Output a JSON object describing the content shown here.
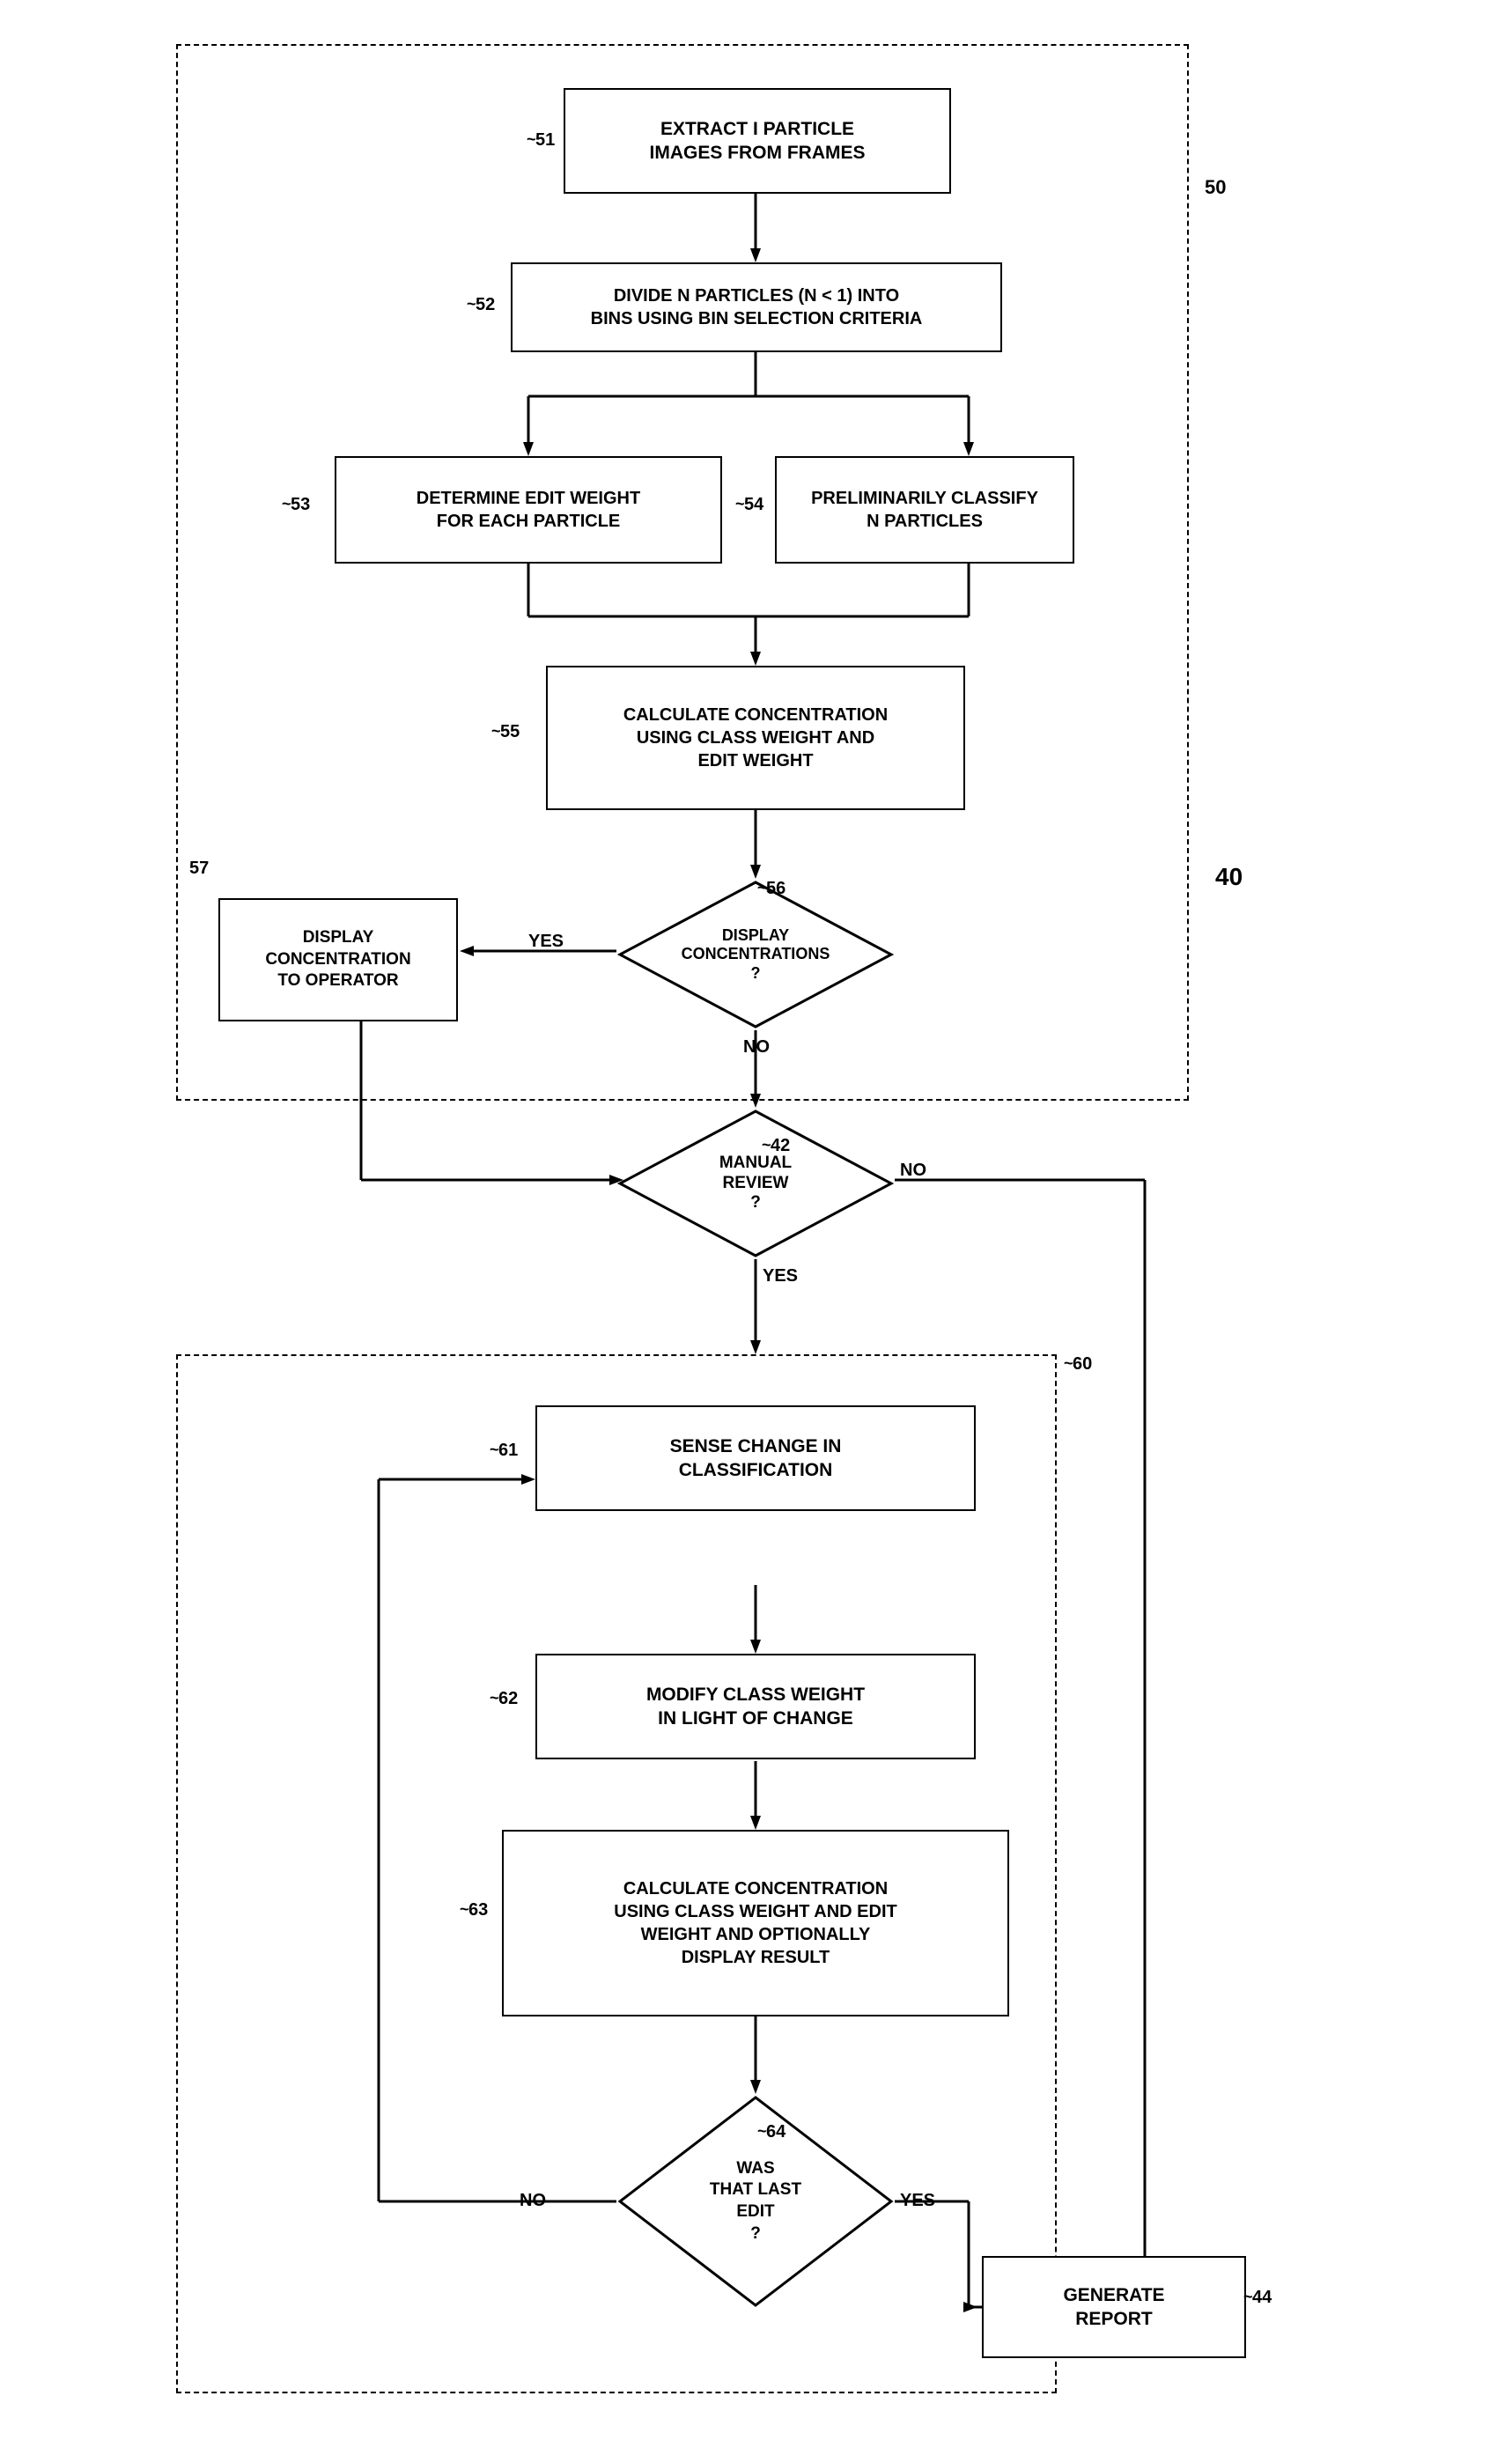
{
  "boxes": {
    "box51": {
      "label": "EXTRACT I PARTICLE\nIMAGES FROM FRAMES",
      "ref": "51"
    },
    "box52": {
      "label": "DIVIDE N PARTICLES (N < 1) INTO\nBINS USING BIN SELECTION CRITERIA",
      "ref": "52"
    },
    "box53": {
      "label": "DETERMINE EDIT WEIGHT\nFOR EACH PARTICLE",
      "ref": "53"
    },
    "box54": {
      "label": "PRELIMINARILY CLASSIFY\nN PARTICLES",
      "ref": "54"
    },
    "box55": {
      "label": "CALCULATE CONCENTRATION\nUSING CLASS WEIGHT AND\nEDIT WEIGHT",
      "ref": "55"
    },
    "box57": {
      "label": "DISPLAY\nCONCENTRATION\nTO OPERATOR",
      "ref": "57"
    },
    "diamond56": {
      "label": "DISPLAY\nCONCENTRATIONS\n?",
      "ref": "56"
    },
    "diamond42": {
      "label": "MANUAL\nREVIEW\n?",
      "ref": "42"
    },
    "box61": {
      "label": "SENSE CHANGE IN\nCLASSIFICATION",
      "ref": "61"
    },
    "box62": {
      "label": "MODIFY CLASS WEIGHT\nIN LIGHT OF CHANGE",
      "ref": "62"
    },
    "box63": {
      "label": "CALCULATE CONCENTRATION\nUSING CLASS WEIGHT AND EDIT\nWEIGHT AND OPTIONALLY\nDISPLAY RESULT",
      "ref": "63"
    },
    "diamond64": {
      "label": "WAS\nTHAT LAST\nEDIT\n?",
      "ref": "64"
    },
    "box44": {
      "label": "GENERATE\nREPORT",
      "ref": "44"
    },
    "region50": {
      "ref": "50"
    },
    "region40": {
      "ref": "40"
    },
    "region60": {
      "ref": "60"
    },
    "yes_label": "YES",
    "no_label": "NO",
    "yes2_label": "YES",
    "no2_label": "NO",
    "yes3_label": "YES",
    "no3_label": "NO"
  }
}
